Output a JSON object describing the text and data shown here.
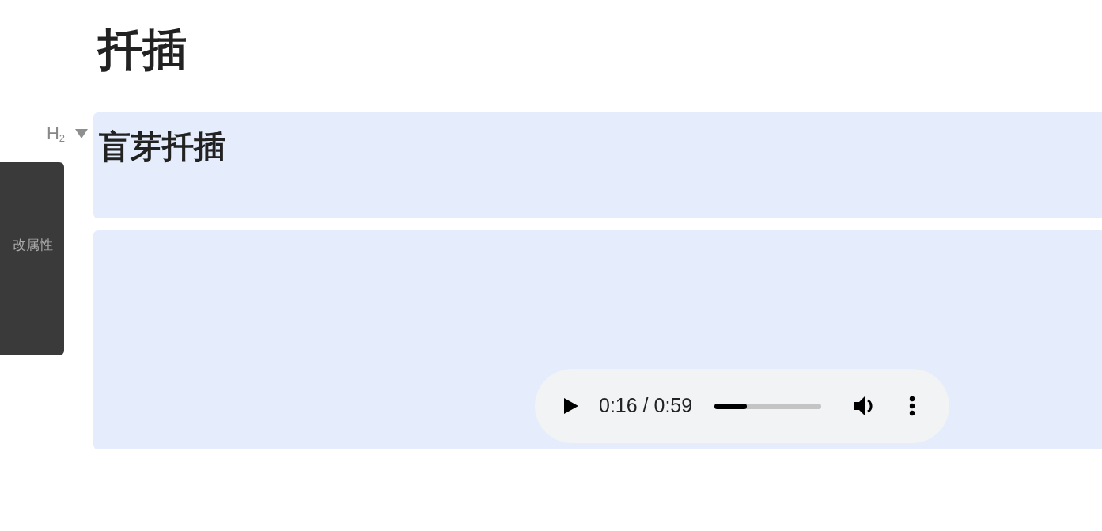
{
  "title": "扦插",
  "blocks": [
    {
      "kind": "heading",
      "level_label": "H",
      "level_sub": "2",
      "text": "盲芽扦插"
    },
    {
      "kind": "audio",
      "time": "0:16 / 0:59",
      "playing": false,
      "level": 0.3
    }
  ],
  "tooltip": {
    "lines": [
      "改属性"
    ]
  }
}
